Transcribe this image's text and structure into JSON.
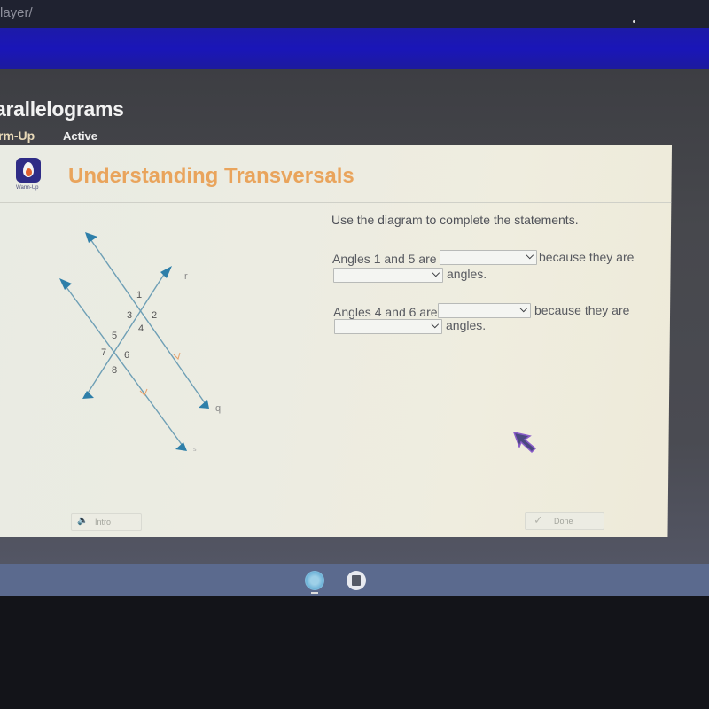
{
  "browser": {
    "url_fragment": "layer/"
  },
  "course": {
    "title": "arallelograms",
    "activity_type": "rm-Up",
    "status": "Active"
  },
  "card": {
    "logo_label": "Warm-Up",
    "logo_icon": "flame-icon",
    "lesson_title": "Understanding Transversals",
    "instructions": "Use the diagram to complete the statements.",
    "statements": [
      {
        "prefix": "Angles 1 and 5 are",
        "select1_value": "",
        "middle": "because they are",
        "select2_value": "",
        "suffix": "angles."
      },
      {
        "prefix": "Angles 4 and 6 are",
        "select1_value": "",
        "middle": "because they are",
        "select2_value": "",
        "suffix": "angles."
      }
    ],
    "diagram": {
      "lines": [
        "q",
        "s",
        "r"
      ],
      "angle_labels": [
        "1",
        "2",
        "3",
        "4",
        "5",
        "6",
        "7",
        "8"
      ],
      "line_color": "#5a93ad",
      "arrow_color": "#2f7fa8",
      "parallel_mark_color": "#e6a06a"
    },
    "footer": {
      "intro_label": "Intro",
      "done_label": "Done"
    }
  },
  "shelf": {
    "apps": [
      "chrome-icon",
      "files-icon"
    ]
  },
  "colors": {
    "blue_band": "#1a16b8",
    "lesson_title": "#e9a45c",
    "logo_bg": "#2f2c86"
  }
}
